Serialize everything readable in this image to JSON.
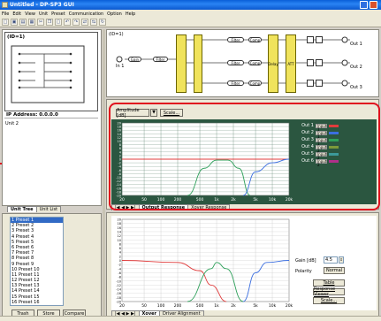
{
  "window": {
    "title": "Untitled - DP-SP3 GUI"
  },
  "menu": [
    "File",
    "Edit",
    "View",
    "Unit",
    "Preset",
    "Communication",
    "Option",
    "Help"
  ],
  "toolbar_icons": [
    "new-icon",
    "open-icon",
    "save-icon",
    "print-icon",
    "cut-icon",
    "copy-icon",
    "paste-icon",
    "undo-icon",
    "redo-icon",
    "connect-icon",
    "disconnect-icon",
    "refresh-icon"
  ],
  "unit_view": {
    "id_label": "(ID=1)",
    "ip_label": "IP Address: 0.0.0.0",
    "unit_name": "Unit 2",
    "tabs": [
      "Unit Tree",
      "Unit List"
    ]
  },
  "presets": {
    "items": [
      "Preset 1",
      "Preset 2",
      "Preset 3",
      "Preset 4",
      "Preset 5",
      "Preset 6",
      "Preset 7",
      "Preset 8",
      "Preset 9",
      "Preset 10",
      "Preset 11",
      "Preset 12",
      "Preset 13",
      "Preset 14",
      "Preset 15",
      "Preset 16"
    ],
    "selected": 0,
    "buttons": {
      "trash": "Trash",
      "store": "Store",
      "compare": "Compare"
    }
  },
  "block_diagram": {
    "id_label": "(ID=1)",
    "input": "In 1",
    "blocks": [
      "Gain",
      "Filter",
      "Filter",
      "Comp",
      "Delay",
      "ATT"
    ],
    "outputs": [
      "Out 1",
      "Out 2",
      "Out 3"
    ]
  },
  "response_panel": {
    "mode": "Amplitude [dB]",
    "scale_label": "Scale...",
    "tabs": [
      "Output Response",
      "Xover Response"
    ],
    "legend": [
      {
        "out": "Out 1",
        "input": "Input 1",
        "color": "#e03c3c"
      },
      {
        "out": "Out 2",
        "input": "Input 1",
        "color": "#3c6fe0"
      },
      {
        "out": "Out 3",
        "input": "Input 1",
        "color": "#2ea05a"
      },
      {
        "out": "Out 4",
        "input": "Input 2",
        "color": "#7b9a3a"
      },
      {
        "out": "Out 5",
        "input": "Input 2",
        "color": "#3c9a9a"
      },
      {
        "out": "Out 6",
        "input": "Input 2",
        "color": "#b0308a"
      }
    ]
  },
  "xover_panel": {
    "gain_label": "Gain [dB]",
    "gain_value": "4.5",
    "polarity_label": "Polarity",
    "polarity_value": "Normal",
    "table_label": "Table",
    "viewer_label": "Response Viewer",
    "scale_label": "Scale...",
    "tabs": [
      "Xover",
      "Driver Alignment"
    ]
  },
  "chart_data": [
    {
      "type": "line",
      "xscale": "log",
      "xlim": [
        20,
        20000
      ],
      "ylim": [
        -20,
        20
      ],
      "x_ticks": [
        "20",
        "50",
        "100",
        "200",
        "500",
        "1k",
        "2k",
        "5k",
        "10k",
        "20k"
      ],
      "y_ticks": [
        "20",
        "18",
        "16",
        "14",
        "12",
        "10",
        "8",
        "6",
        "4",
        "2",
        "0",
        "-2",
        "-4",
        "-6",
        "-8",
        "-10",
        "-12",
        "-14",
        "-16",
        "-18",
        "-20"
      ],
      "series": [
        {
          "name": "Out 1",
          "color": "#e03c3c",
          "x": [
            20,
            1000,
            20000
          ],
          "y": [
            0,
            0,
            0
          ]
        },
        {
          "name": "Out 3",
          "color": "#2ea05a",
          "x": [
            300,
            600,
            1000,
            1600,
            2500,
            4000
          ],
          "y": [
            -20,
            -5,
            -0.5,
            -0.5,
            -5,
            -20
          ]
        },
        {
          "name": "Out 2",
          "color": "#3c6fe0",
          "x": [
            3000,
            5000,
            10000,
            20000
          ],
          "y": [
            -20,
            -7,
            -2,
            0
          ]
        }
      ]
    },
    {
      "type": "line",
      "xscale": "log",
      "xlim": [
        20,
        20000
      ],
      "ylim": [
        -20,
        20
      ],
      "x_ticks": [
        "20",
        "50",
        "100",
        "200",
        "500",
        "1k",
        "2k",
        "5k",
        "10k",
        "20k"
      ],
      "y_ticks": [
        "20",
        "18",
        "16",
        "14",
        "12",
        "10",
        "8",
        "6",
        "4",
        "2",
        "0",
        "-2",
        "-4",
        "-6",
        "-8",
        "-10",
        "-12",
        "-14",
        "-16",
        "-18",
        "-20"
      ],
      "series": [
        {
          "color": "#e03c3c",
          "x": [
            20,
            200,
            500,
            800,
            1500
          ],
          "y": [
            0,
            -1,
            -5,
            -12,
            -20
          ]
        },
        {
          "color": "#2ea05a",
          "x": [
            300,
            800,
            1000,
            1500,
            3000
          ],
          "y": [
            -20,
            -4,
            -1,
            -4,
            -20
          ]
        },
        {
          "color": "#3c6fe0",
          "x": [
            3000,
            5000,
            8000,
            20000
          ],
          "y": [
            -20,
            -6,
            -1,
            0
          ]
        }
      ]
    }
  ]
}
